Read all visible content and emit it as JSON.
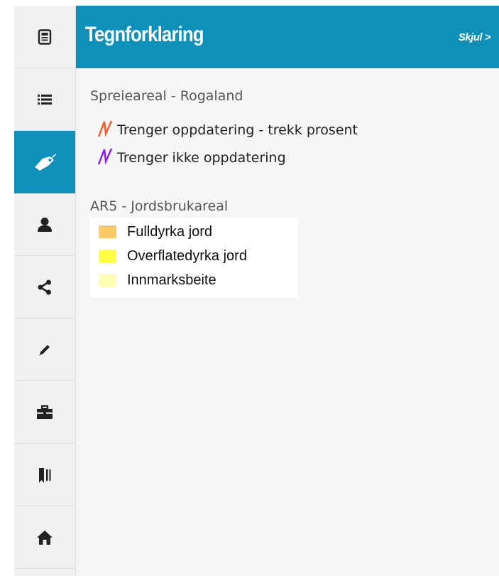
{
  "sidebar": {
    "items": [
      {
        "name": "document-icon",
        "active": false
      },
      {
        "name": "list-icon",
        "active": false
      },
      {
        "name": "tag-icon",
        "active": true
      },
      {
        "name": "user-icon",
        "active": false
      },
      {
        "name": "share-icon",
        "active": false
      },
      {
        "name": "pencil-icon",
        "active": false
      },
      {
        "name": "briefcase-icon",
        "active": false
      },
      {
        "name": "bookmarks-icon",
        "active": false
      },
      {
        "name": "home-icon",
        "active": false
      }
    ]
  },
  "panel": {
    "title": "Tegnforklaring",
    "hide_label": "Skjul >"
  },
  "legend": {
    "group1": {
      "title": "Spreieareal - Rogaland",
      "items": [
        {
          "label": "Trenger oppdatering - trekk prosent",
          "color": "#ff5522"
        },
        {
          "label": "Trenger ikke oppdatering",
          "color": "#8a1cff"
        }
      ]
    },
    "group2": {
      "title": "AR5 - Jordsbrukareal",
      "items": [
        {
          "label": "Fulldyrka jord",
          "color": "#ffc966"
        },
        {
          "label": "Overflatedyrka jord",
          "color": "#ffff44"
        },
        {
          "label": "Innmarksbeite",
          "color": "#ffffb3"
        }
      ]
    }
  },
  "colors": {
    "accent": "#0f90b9",
    "sidebar_bg": "#f1f1f1",
    "panel_bg": "#f6f6f6"
  }
}
